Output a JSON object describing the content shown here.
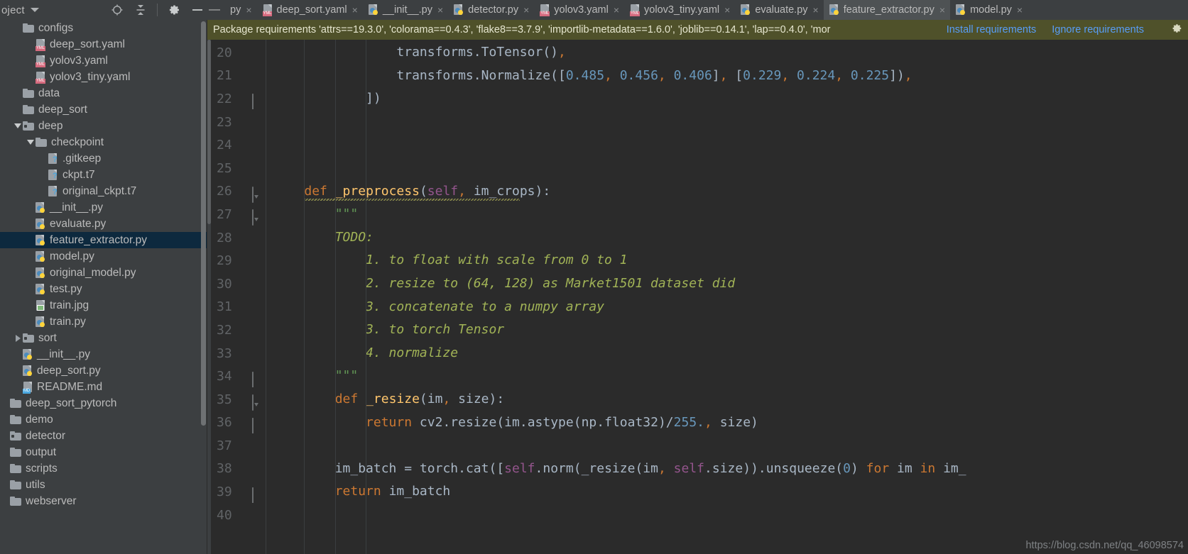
{
  "project_panel": {
    "title": "oject",
    "caret_icon": "chevron-down-icon",
    "toolbar": [
      {
        "name": "locate-target-icon"
      },
      {
        "name": "collapse-all-icon"
      },
      {
        "name": "settings-gear-icon"
      },
      {
        "name": "hide-panel-icon"
      }
    ]
  },
  "tree": [
    {
      "label": "configs",
      "icon": "folder-icon",
      "indent": 0,
      "arrow": "none",
      "selected": false
    },
    {
      "label": "deep_sort.yaml",
      "icon": "yaml-file-icon",
      "indent": 1,
      "arrow": "none",
      "selected": false
    },
    {
      "label": "yolov3.yaml",
      "icon": "yaml-file-icon",
      "indent": 1,
      "arrow": "none",
      "selected": false
    },
    {
      "label": "yolov3_tiny.yaml",
      "icon": "yaml-file-icon",
      "indent": 1,
      "arrow": "none",
      "selected": false
    },
    {
      "label": "data",
      "icon": "folder-icon",
      "indent": 0,
      "arrow": "none",
      "selected": false
    },
    {
      "label": "deep_sort",
      "icon": "folder-icon",
      "indent": 0,
      "arrow": "none",
      "selected": false
    },
    {
      "label": "deep",
      "icon": "source-folder-icon",
      "indent": 0,
      "arrow": "down",
      "selected": false
    },
    {
      "label": "checkpoint",
      "icon": "folder-icon",
      "indent": 1,
      "arrow": "down",
      "selected": false
    },
    {
      "label": ".gitkeep",
      "icon": "unknown-file-icon",
      "indent": 2,
      "arrow": "none",
      "selected": false
    },
    {
      "label": "ckpt.t7",
      "icon": "unknown-file-icon",
      "indent": 2,
      "arrow": "none",
      "selected": false
    },
    {
      "label": "original_ckpt.t7",
      "icon": "unknown-file-icon",
      "indent": 2,
      "arrow": "none",
      "selected": false
    },
    {
      "label": "__init__.py",
      "icon": "python-file-icon",
      "indent": 1,
      "arrow": "none",
      "selected": false
    },
    {
      "label": "evaluate.py",
      "icon": "python-file-icon",
      "indent": 1,
      "arrow": "none",
      "selected": false
    },
    {
      "label": "feature_extractor.py",
      "icon": "python-file-icon",
      "indent": 1,
      "arrow": "none",
      "selected": true
    },
    {
      "label": "model.py",
      "icon": "python-file-icon",
      "indent": 1,
      "arrow": "none",
      "selected": false
    },
    {
      "label": "original_model.py",
      "icon": "python-file-icon",
      "indent": 1,
      "arrow": "none",
      "selected": false
    },
    {
      "label": "test.py",
      "icon": "python-file-icon",
      "indent": 1,
      "arrow": "none",
      "selected": false
    },
    {
      "label": "train.jpg",
      "icon": "image-file-icon",
      "indent": 1,
      "arrow": "none",
      "selected": false
    },
    {
      "label": "train.py",
      "icon": "python-file-icon",
      "indent": 1,
      "arrow": "none",
      "selected": false
    },
    {
      "label": "sort",
      "icon": "source-folder-icon",
      "indent": 0,
      "arrow": "right",
      "selected": false
    },
    {
      "label": "__init__.py",
      "icon": "python-file-icon",
      "indent": 0,
      "arrow": "none",
      "selected": false
    },
    {
      "label": "deep_sort.py",
      "icon": "python-file-icon",
      "indent": 0,
      "arrow": "none",
      "selected": false
    },
    {
      "label": "README.md",
      "icon": "markdown-file-icon",
      "indent": 0,
      "arrow": "none",
      "selected": false
    },
    {
      "label": "deep_sort_pytorch",
      "icon": "folder-icon",
      "indent": -1,
      "arrow": "none",
      "selected": false
    },
    {
      "label": "demo",
      "icon": "folder-icon",
      "indent": -1,
      "arrow": "none",
      "selected": false
    },
    {
      "label": "detector",
      "icon": "source-folder-icon",
      "indent": -1,
      "arrow": "none",
      "selected": false
    },
    {
      "label": "output",
      "icon": "folder-icon",
      "indent": -1,
      "arrow": "none",
      "selected": false
    },
    {
      "label": "scripts",
      "icon": "folder-icon",
      "indent": -1,
      "arrow": "none",
      "selected": false
    },
    {
      "label": "utils",
      "icon": "folder-icon",
      "indent": -1,
      "arrow": "none",
      "selected": false
    },
    {
      "label": "webserver",
      "icon": "folder-icon",
      "indent": -1,
      "arrow": "none",
      "selected": false
    }
  ],
  "tabs": {
    "leading_dash": "—",
    "items": [
      {
        "label": "py",
        "icon": "none",
        "active": false,
        "close": "×"
      },
      {
        "label": "deep_sort.yaml",
        "icon": "yaml-file-icon",
        "active": false,
        "close": "×"
      },
      {
        "label": "__init__.py",
        "icon": "python-file-icon",
        "active": false,
        "close": "×"
      },
      {
        "label": "detector.py",
        "icon": "python-file-icon",
        "active": false,
        "close": "×"
      },
      {
        "label": "yolov3.yaml",
        "icon": "yaml-file-icon",
        "active": false,
        "close": "×"
      },
      {
        "label": "yolov3_tiny.yaml",
        "icon": "yaml-file-icon",
        "active": false,
        "close": "×"
      },
      {
        "label": "evaluate.py",
        "icon": "python-file-icon",
        "active": false,
        "close": "×"
      },
      {
        "label": "feature_extractor.py",
        "icon": "python-file-icon",
        "active": true,
        "close": "×"
      },
      {
        "label": "model.py",
        "icon": "python-file-icon",
        "active": false,
        "close": "×"
      }
    ]
  },
  "notification": {
    "message": "Package requirements 'attrs==19.3.0', 'colorama==0.4.3', 'flake8==3.7.9', 'importlib-metadata==1.6.0', 'joblib==0.14.1', 'lap==0.4.0', 'mor",
    "install_label": "Install requirements",
    "ignore_label": "Ignore requirements",
    "gear_icon": "settings-gear-icon",
    "bg_color": "#4f512a",
    "link_color": "#589df6"
  },
  "editor": {
    "first_line": 20,
    "lines": [
      {
        "n": 20,
        "fold": "none",
        "text": "                transforms.ToTensor(),"
      },
      {
        "n": 21,
        "fold": "none",
        "text": "                transforms.Normalize([0.485, 0.456, 0.406], [0.229, 0.224, 0.225]),"
      },
      {
        "n": 22,
        "fold": "end",
        "text": "            ])"
      },
      {
        "n": 23,
        "fold": "none",
        "text": ""
      },
      {
        "n": 24,
        "fold": "none",
        "text": ""
      },
      {
        "n": 25,
        "fold": "none",
        "text": ""
      },
      {
        "n": 26,
        "fold": "start",
        "text": "    def _preprocess(self, im_crops):"
      },
      {
        "n": 27,
        "fold": "start",
        "text": "        \"\"\""
      },
      {
        "n": 28,
        "fold": "none",
        "text": "        TODO:"
      },
      {
        "n": 29,
        "fold": "none",
        "text": "            1. to float with scale from 0 to 1"
      },
      {
        "n": 30,
        "fold": "none",
        "text": "            2. resize to (64, 128) as Market1501 dataset did"
      },
      {
        "n": 31,
        "fold": "none",
        "text": "            3. concatenate to a numpy array"
      },
      {
        "n": 32,
        "fold": "none",
        "text": "            3. to torch Tensor"
      },
      {
        "n": 33,
        "fold": "none",
        "text": "            4. normalize"
      },
      {
        "n": 34,
        "fold": "end",
        "text": "        \"\"\""
      },
      {
        "n": 35,
        "fold": "start",
        "text": "        def _resize(im, size):"
      },
      {
        "n": 36,
        "fold": "end",
        "text": "            return cv2.resize(im.astype(np.float32)/255., size)"
      },
      {
        "n": 37,
        "fold": "none",
        "text": ""
      },
      {
        "n": 38,
        "fold": "none",
        "text": "        im_batch = torch.cat([self.norm(_resize(im, self.size)).unsqueeze(0) for im in im_"
      },
      {
        "n": 39,
        "fold": "end",
        "text": "        return im_batch"
      },
      {
        "n": 40,
        "fold": "none",
        "text": ""
      }
    ],
    "background": "#2b2b2b",
    "line_number_color": "#606366"
  },
  "watermark": "https://blog.csdn.net/qq_46098574"
}
